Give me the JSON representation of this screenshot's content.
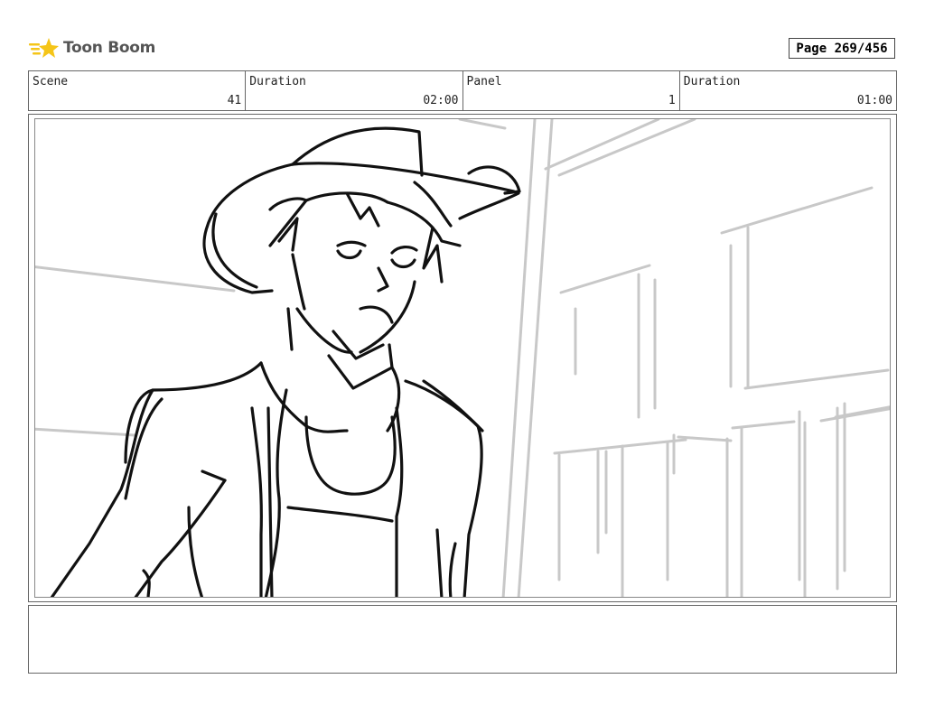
{
  "header": {
    "logo_text": "Toon Boom",
    "logo_icon": "toon-boom-star-logo",
    "page_label": "Page 269/456"
  },
  "info": {
    "scene_label": "Scene",
    "scene_value": "41",
    "duration1_label": "Duration",
    "duration1_value": "02:00",
    "panel_label": "Panel",
    "panel_value": "1",
    "duration2_label": "Duration",
    "duration2_value": "01:00"
  },
  "panel": {
    "image": "sketch-cowboy-character-street",
    "accent_colors": {
      "ink": "#111111",
      "background_lines": "#c8c8c8",
      "logo_yellow": "#f5c518"
    }
  },
  "notes": {
    "text": ""
  }
}
